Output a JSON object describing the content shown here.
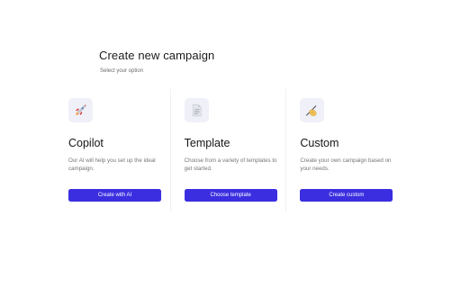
{
  "header": {
    "title": "Create new campaign",
    "subtitle": "Select your option"
  },
  "options": [
    {
      "icon": "rocket-icon",
      "title": "Copilot",
      "description": "Our AI will help you set up the ideal campaign.",
      "button_label": "Create with AI"
    },
    {
      "icon": "document-icon",
      "title": "Template",
      "description": "Choose from a variety of templates to get started.",
      "button_label": "Choose template"
    },
    {
      "icon": "writing-hand-icon",
      "title": "Custom",
      "description": "Create your own campaign based on your needs.",
      "button_label": "Create custom"
    }
  ],
  "colors": {
    "primary_button": "#3a2ee0",
    "icon_tile": "#eff0f8"
  }
}
